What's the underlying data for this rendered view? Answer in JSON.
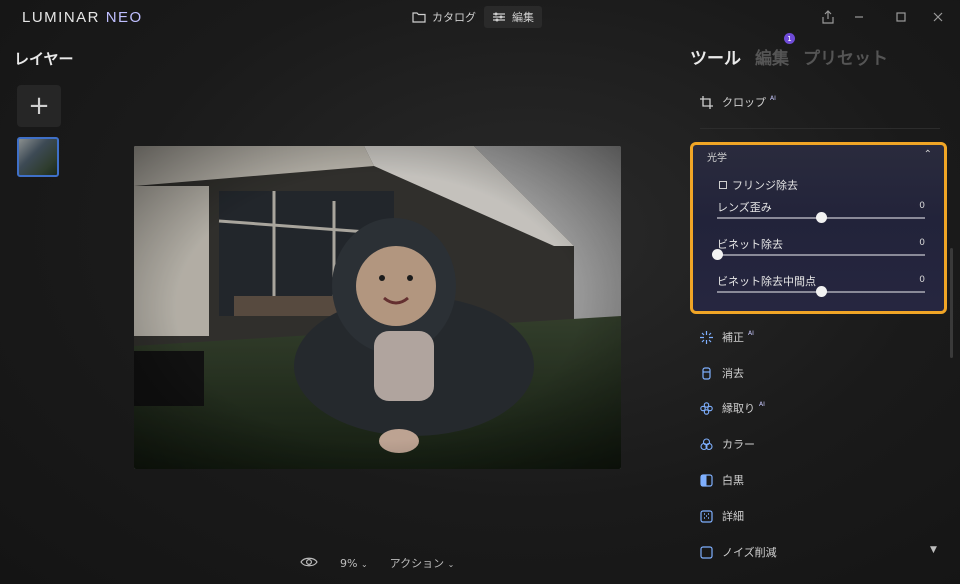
{
  "app": {
    "logo_main": "LUMINAR",
    "logo_sub": "NEO"
  },
  "topbar": {
    "tabs": [
      {
        "label": "カタログ",
        "icon": "folder-icon"
      },
      {
        "label": "編集",
        "icon": "sliders-icon"
      }
    ]
  },
  "layers": {
    "title": "レイヤー",
    "add_symbol": "+"
  },
  "bottombar": {
    "zoom": "9%",
    "actions": "アクション"
  },
  "panel": {
    "tabs": [
      {
        "label": "ツール",
        "active": true
      },
      {
        "label": "編集",
        "badge": "1"
      },
      {
        "label": "プリセット"
      }
    ],
    "crop": {
      "label": "クロップ",
      "ai": "AI"
    },
    "optics": {
      "title": "光学",
      "checkbox_label": "フリンジ除去",
      "sliders": [
        {
          "label": "レンズ歪み",
          "value": "0",
          "position": 0.5
        },
        {
          "label": "ビネット除去",
          "value": "0",
          "position": 0.0
        },
        {
          "label": "ビネット除去中間点",
          "value": "0",
          "position": 0.5
        }
      ]
    },
    "tools": [
      {
        "label": "補正",
        "ai": "AI",
        "icon": "sparkle-icon"
      },
      {
        "label": "消去",
        "ai": "",
        "icon": "eraser-icon"
      },
      {
        "label": "縁取り",
        "ai": "AI",
        "icon": "flower-icon"
      },
      {
        "label": "カラー",
        "ai": "",
        "icon": "color-circles-icon"
      },
      {
        "label": "白黒",
        "ai": "",
        "icon": "half-square-icon"
      },
      {
        "label": "詳細",
        "ai": "",
        "icon": "grid-icon"
      },
      {
        "label": "ノイズ削減",
        "ai": "",
        "icon": "square-outline-icon"
      }
    ]
  }
}
